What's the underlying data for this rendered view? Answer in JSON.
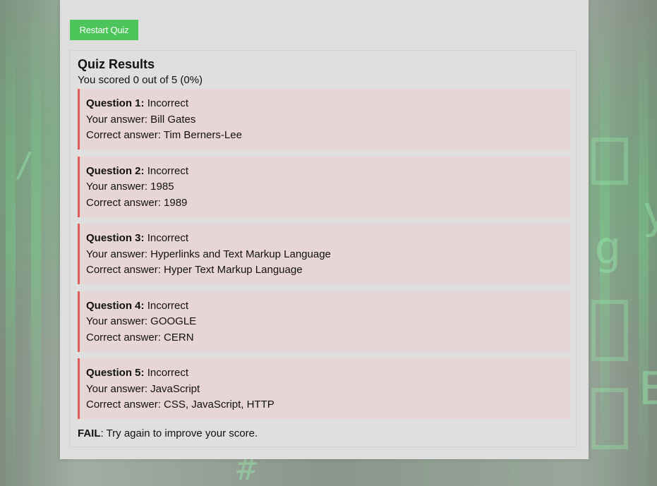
{
  "quiz": {
    "restart_label": "Restart Quiz",
    "results_title": "Quiz Results",
    "score_text": "You scored 0 out of 5 (0%)",
    "questions": [
      {
        "label": "Question 1:",
        "status": "Incorrect",
        "your_answer": "Your answer: Bill Gates",
        "correct_answer": "Correct answer: Tim Berners-Lee"
      },
      {
        "label": "Question 2:",
        "status": "Incorrect",
        "your_answer": "Your answer: 1985",
        "correct_answer": "Correct answer: 1989"
      },
      {
        "label": "Question 3:",
        "status": "Incorrect",
        "your_answer": "Your answer: Hyperlinks and Text Markup Language",
        "correct_answer": "Correct answer: Hyper Text Markup Language"
      },
      {
        "label": "Question 4:",
        "status": "Incorrect",
        "your_answer": "Your answer: GOOGLE",
        "correct_answer": "Correct answer: CERN"
      },
      {
        "label": "Question 5:",
        "status": "Incorrect",
        "your_answer": "Your answer: JavaScript",
        "correct_answer": "Correct answer: CSS, JavaScript, HTTP"
      }
    ],
    "verdict_label": "FAIL",
    "verdict_text": ": Try again to improve your score."
  },
  "colors": {
    "button_green": "#4cc55a",
    "incorrect_border": "#e05a5a",
    "incorrect_bg": "#e8d6d6"
  }
}
